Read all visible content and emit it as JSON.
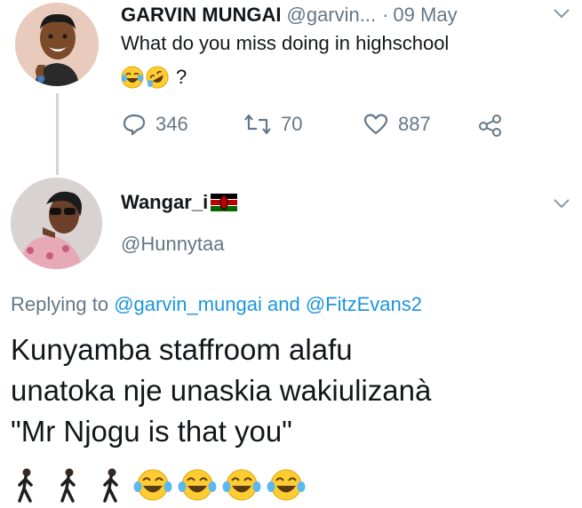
{
  "tweet": {
    "display_name": "GARVIN MUNGAI",
    "handle": "@garvin...",
    "separator": "·",
    "date": "09 May",
    "text": "What do you miss doing in highschool",
    "text_tail": "?",
    "emoji_icons": [
      "face-with-tears-of-joy-icon",
      "rolling-on-floor-laughing-icon"
    ],
    "actions": {
      "reply_count": "346",
      "retweet_count": "70",
      "like_count": "887"
    }
  },
  "reply": {
    "display_name": "Wangar_i",
    "flag_icon": "kenya-flag-icon",
    "handle": "@Hunnytaa",
    "replying_prefix": "Replying to",
    "replying_to_1": "@garvin_mungai",
    "replying_and": "and",
    "replying_to_2": "@FitzEvans2",
    "text_line1": "Kunyamba staffroom alafu",
    "text_line2": "unatoka nje unaskia wakiulizanà",
    "text_line3": "\"Mr Njogu is that you\"",
    "emoji_icons": [
      "person-walking-icon",
      "person-walking-icon",
      "person-walking-icon",
      "face-with-tears-of-joy-icon",
      "face-with-tears-of-joy-icon",
      "face-with-tears-of-joy-icon",
      "face-with-tears-of-joy-icon"
    ]
  },
  "colors": {
    "text": "#14171a",
    "secondary": "#657786",
    "link": "#1b95e0",
    "thread_line": "#ccd6dd",
    "emoji_yellow": "#ffcc33"
  }
}
